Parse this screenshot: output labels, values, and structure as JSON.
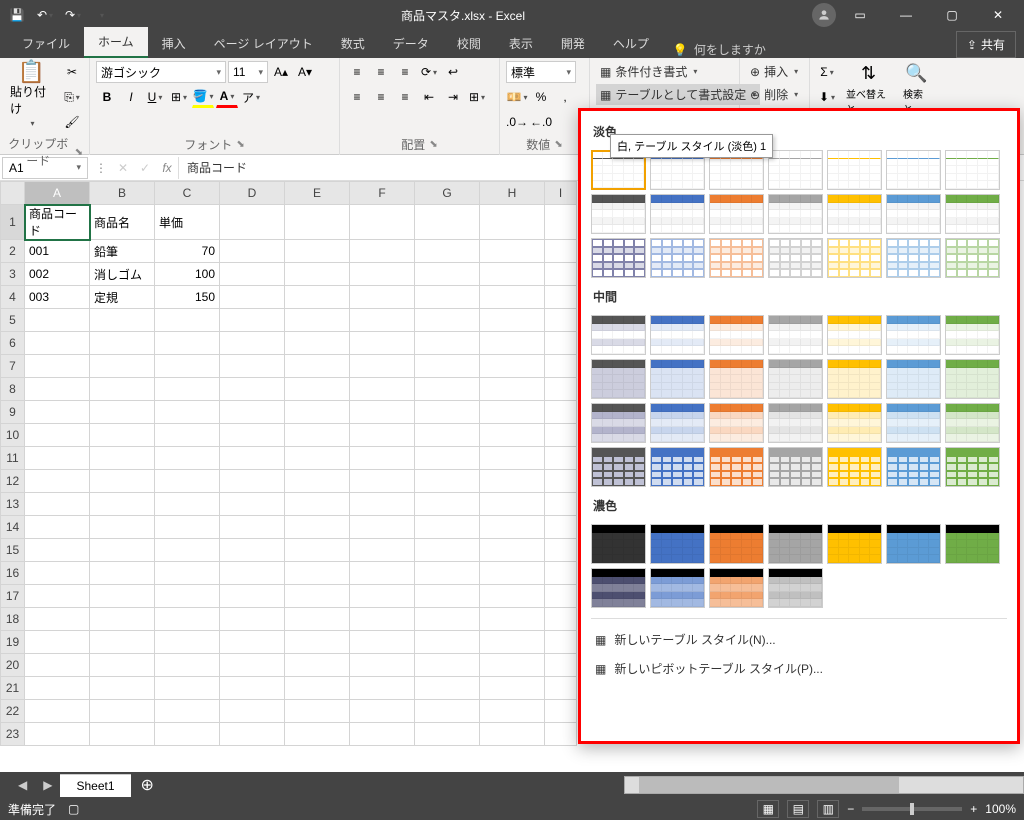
{
  "title": "商品マスタ.xlsx - Excel",
  "tabs": {
    "file": "ファイル",
    "home": "ホーム",
    "insert": "挿入",
    "layout": "ページ レイアウト",
    "formulas": "数式",
    "data": "データ",
    "review": "校閲",
    "view": "表示",
    "dev": "開発",
    "help": "ヘルプ"
  },
  "tellme": "何をしますか",
  "share": "共有",
  "ribbon": {
    "clipboard": {
      "label": "クリップボード",
      "paste": "貼り付け"
    },
    "font": {
      "label": "フォント",
      "name": "游ゴシック",
      "size": "11"
    },
    "align": {
      "label": "配置"
    },
    "number": {
      "label": "数値",
      "format": "標準"
    },
    "styles": {
      "cond": "条件付き書式",
      "table": "テーブルとして書式設定"
    },
    "cells": {
      "insert": "挿入",
      "delete": "削除"
    }
  },
  "namebox": "A1",
  "formula": "商品コード",
  "cols": [
    "A",
    "B",
    "C",
    "D",
    "E",
    "F",
    "G",
    "H",
    "I"
  ],
  "rows": [
    1,
    2,
    3,
    4,
    5,
    6,
    7,
    8,
    9,
    10,
    11,
    12,
    13,
    14,
    15,
    16,
    17,
    18,
    19,
    20,
    21,
    22,
    23
  ],
  "data": {
    "r1": {
      "a": "商品コード",
      "b": "商品名",
      "c": "単価"
    },
    "r2": {
      "a": "001",
      "b": "鉛筆",
      "c": "70"
    },
    "r3": {
      "a": "002",
      "b": "消しゴム",
      "c": "100"
    },
    "r4": {
      "a": "003",
      "b": "定規",
      "c": "150"
    }
  },
  "sheet": "Sheet1",
  "status": "準備完了",
  "zoom": "100%",
  "gallery": {
    "section_light": "淡色",
    "section_medium": "中間",
    "section_dark": "濃色",
    "tooltip": "白, テーブル スタイル (淡色) 1",
    "new_table": "新しいテーブル スタイル(N)...",
    "new_pivot": "新しいピボットテーブル スタイル(P)..."
  },
  "swatch_colors": {
    "light": [
      "#555",
      "#4472c4",
      "#ed7d31",
      "#a5a5a5",
      "#ffc000",
      "#5b9bd5",
      "#70ad47"
    ],
    "medium": [
      "#555",
      "#4472c4",
      "#ed7d31",
      "#a5a5a5",
      "#ffc000",
      "#5b9bd5",
      "#70ad47"
    ],
    "dark": [
      "#333",
      "#4472c4",
      "#ed7d31",
      "#a5a5a5",
      "#ffc000",
      "#5b9bd5",
      "#70ad47"
    ]
  }
}
